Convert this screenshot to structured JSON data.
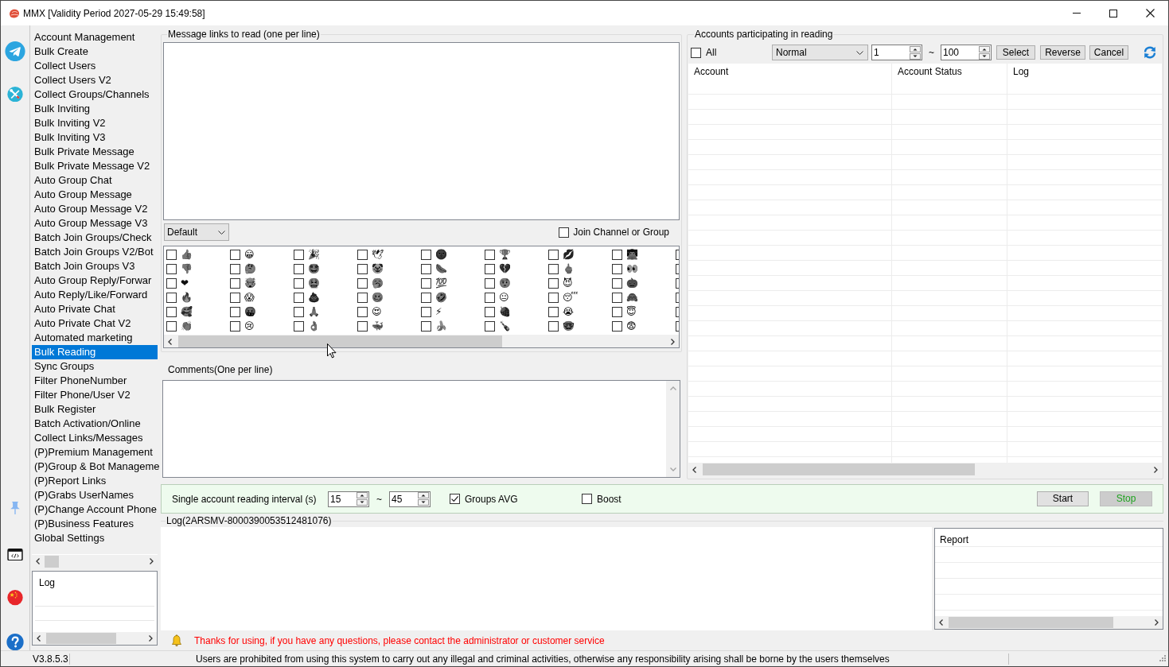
{
  "window": {
    "title": "MMX [Validity Period 2027-05-29 15:49:58]"
  },
  "sidebar": {
    "items": [
      {
        "label": "Account Management",
        "selected": false
      },
      {
        "label": "Bulk Create",
        "selected": false
      },
      {
        "label": "Collect Users",
        "selected": false
      },
      {
        "label": "Collect Users V2",
        "selected": false
      },
      {
        "label": "Collect Groups/Channels",
        "selected": false
      },
      {
        "label": "Bulk Inviting",
        "selected": false
      },
      {
        "label": "Bulk Inviting V2",
        "selected": false
      },
      {
        "label": "Bulk Inviting V3",
        "selected": false
      },
      {
        "label": "Bulk Private Message",
        "selected": false
      },
      {
        "label": "Bulk Private Message V2",
        "selected": false
      },
      {
        "label": "Auto Group Chat",
        "selected": false
      },
      {
        "label": "Auto Group Message",
        "selected": false
      },
      {
        "label": "Auto Group Message V2",
        "selected": false
      },
      {
        "label": "Auto Group Message V3",
        "selected": false
      },
      {
        "label": "Batch Join Groups/Check",
        "selected": false
      },
      {
        "label": "Batch Join Groups V2/Bot",
        "selected": false
      },
      {
        "label": "Batch Join Groups V3",
        "selected": false
      },
      {
        "label": "Auto Group Reply/Forwar",
        "selected": false
      },
      {
        "label": "Auto Reply/Like/Forward",
        "selected": false
      },
      {
        "label": "Auto Private Chat",
        "selected": false
      },
      {
        "label": "Auto Private Chat V2",
        "selected": false
      },
      {
        "label": "Automated marketing",
        "selected": false
      },
      {
        "label": "Bulk Reading",
        "selected": true
      },
      {
        "label": "Sync Groups",
        "selected": false
      },
      {
        "label": "Filter PhoneNumber",
        "selected": false
      },
      {
        "label": "Filter Phone/User V2",
        "selected": false
      },
      {
        "label": "Bulk Register",
        "selected": false
      },
      {
        "label": "Batch Activation/Online",
        "selected": false
      },
      {
        "label": "Collect Links/Messages",
        "selected": false
      },
      {
        "label": "(P)Premium Management",
        "selected": false
      },
      {
        "label": "(P)Group & Bot Manageme",
        "selected": false
      },
      {
        "label": "(P)Report Links",
        "selected": false
      },
      {
        "label": "(P)Grabs UserNames",
        "selected": false
      },
      {
        "label": "(P)Change Account Phone",
        "selected": false
      },
      {
        "label": "(P)Business Features",
        "selected": false
      },
      {
        "label": "Global Settings",
        "selected": false
      }
    ],
    "log_header": "Log"
  },
  "links_panel": {
    "title": "Message links to read (one per line)",
    "preset": "Default",
    "join_channel": {
      "label": "Join Channel or Group",
      "checked": false
    },
    "reactions": [
      {
        "emoji": "👍",
        "checked": false
      },
      {
        "emoji": "👎",
        "checked": false
      },
      {
        "emoji": "❤",
        "checked": false
      },
      {
        "emoji": "🔥",
        "checked": false
      },
      {
        "emoji": "🥰",
        "checked": false
      },
      {
        "emoji": "👏",
        "checked": false
      },
      {
        "emoji": "😁",
        "checked": false
      },
      {
        "emoji": "🤔",
        "checked": false
      },
      {
        "emoji": "🤯",
        "checked": false
      },
      {
        "emoji": "😱",
        "checked": false
      },
      {
        "emoji": "🤬",
        "checked": false
      },
      {
        "emoji": "😢",
        "checked": false
      },
      {
        "emoji": "🎉",
        "checked": false
      },
      {
        "emoji": "🤩",
        "checked": false
      },
      {
        "emoji": "🤮",
        "checked": false
      },
      {
        "emoji": "💩",
        "checked": false
      },
      {
        "emoji": "🙏",
        "checked": false
      },
      {
        "emoji": "👌",
        "checked": false
      },
      {
        "emoji": "🕊",
        "checked": false
      },
      {
        "emoji": "🤡",
        "checked": false
      },
      {
        "emoji": "🥱",
        "checked": false
      },
      {
        "emoji": "🥴",
        "checked": false
      },
      {
        "emoji": "😍",
        "checked": false
      },
      {
        "emoji": "🐳",
        "checked": false
      },
      {
        "emoji": "🌚",
        "checked": false
      },
      {
        "emoji": "🌭",
        "checked": false
      },
      {
        "emoji": "💯",
        "checked": false
      },
      {
        "emoji": "🤣",
        "checked": false
      },
      {
        "emoji": "⚡",
        "checked": false
      },
      {
        "emoji": "🍌",
        "checked": false
      },
      {
        "emoji": "🏆",
        "checked": false
      },
      {
        "emoji": "💔",
        "checked": false
      },
      {
        "emoji": "🤨",
        "checked": false
      },
      {
        "emoji": "😐",
        "checked": false
      },
      {
        "emoji": "🍓",
        "checked": false
      },
      {
        "emoji": "🍾",
        "checked": false
      },
      {
        "emoji": "💋",
        "checked": false
      },
      {
        "emoji": "🖕",
        "checked": false
      },
      {
        "emoji": "😈",
        "checked": false
      },
      {
        "emoji": "😴",
        "checked": false
      },
      {
        "emoji": "😭",
        "checked": false
      },
      {
        "emoji": "🤓",
        "checked": false
      },
      {
        "emoji": "👨‍💻",
        "checked": false
      },
      {
        "emoji": "👀",
        "checked": false
      },
      {
        "emoji": "🎃",
        "checked": false
      },
      {
        "emoji": "🙈",
        "checked": false
      },
      {
        "emoji": "😇",
        "checked": false
      },
      {
        "emoji": "😨",
        "checked": false
      },
      {
        "checked": false
      },
      {
        "checked": false
      },
      {
        "checked": false
      },
      {
        "checked": false
      },
      {
        "checked": false
      },
      {
        "checked": false
      }
    ]
  },
  "comments": {
    "title": "Comments(One per line)"
  },
  "accounts_panel": {
    "title": "Accounts participating in reading",
    "all": {
      "label": "All",
      "checked": false
    },
    "mode": "Normal",
    "range_from": "1",
    "range_separator": "~",
    "range_to": "100",
    "buttons": [
      "Select",
      "Reverse",
      "Cancel"
    ],
    "table": {
      "columns": [
        "Account",
        "Account Status",
        "Log"
      ]
    }
  },
  "controls": {
    "interval_label": "Single account reading interval (s)",
    "interval_from": "15",
    "interval_separator": "~",
    "interval_to": "45",
    "options": [
      {
        "label": "Groups AVG",
        "checked": true
      },
      {
        "label": "Boost",
        "checked": false
      }
    ],
    "buttons": [
      {
        "label": "Start",
        "disabled": false
      },
      {
        "label": "Stop",
        "disabled": true
      }
    ]
  },
  "log_panel": {
    "title": "Log(2ARSMV-8000390053512481076)",
    "report_header": "Report"
  },
  "notice": "Thanks for using, if you have any questions, please contact the administrator or customer service",
  "status_bar": {
    "version": "V3.8.5.3",
    "message": "Users are prohibited from using this system to carry out any illegal and criminal activities, otherwise any responsibility arising shall be borne by the users themselves"
  }
}
